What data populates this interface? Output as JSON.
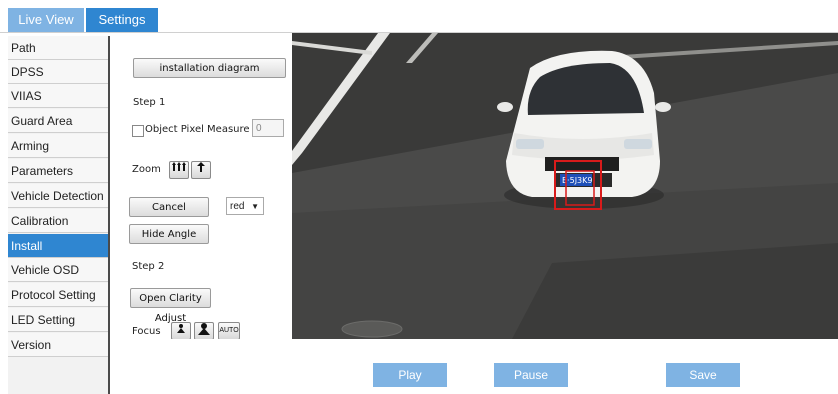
{
  "tabs": {
    "live_view": "Live View",
    "settings": "Settings"
  },
  "sidebar": {
    "items": [
      {
        "label": "Path"
      },
      {
        "label": "DPSS"
      },
      {
        "label": "VIIAS"
      },
      {
        "label": "Guard Area"
      },
      {
        "label": "Arming"
      },
      {
        "label": "Parameters"
      },
      {
        "label": "Vehicle Detection"
      },
      {
        "label": "Calibration"
      },
      {
        "label": "Install"
      },
      {
        "label": "Vehicle OSD"
      },
      {
        "label": "Protocol Setting"
      },
      {
        "label": "LED Setting"
      },
      {
        "label": "Version"
      }
    ],
    "active": "Install"
  },
  "panel": {
    "installation_diagram": "installation diagram",
    "step1": "Step 1",
    "object_pixel_measure": "Object Pixel Measure",
    "object_pixel_value": "0",
    "zoom_label": "Zoom",
    "cancel": "Cancel",
    "color_select": "red",
    "hide_angle": "Hide Angle",
    "step2": "Step 2",
    "open_clarity_adjust": "Open Clarity Adjust",
    "focus_label": "Focus",
    "focus_auto": "AUTO"
  },
  "video": {
    "plate_text": "E·5J3K9"
  },
  "actions": {
    "play": "Play",
    "pause": "Pause",
    "save": "Save"
  },
  "colors": {
    "accent": "#2f86d1",
    "accent_light": "#7fb3e3",
    "detect_box": "#d81b1b"
  }
}
